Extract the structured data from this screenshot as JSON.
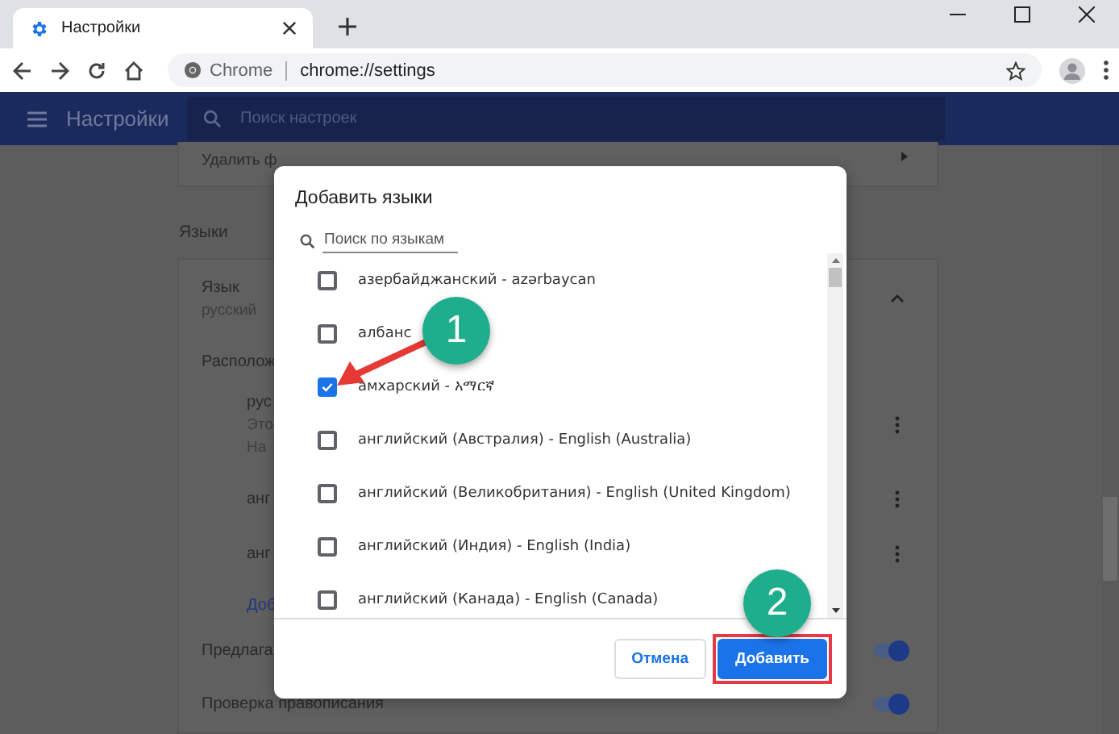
{
  "browser": {
    "tab_title": "Настройки",
    "address_chip": "Chrome",
    "url": "chrome://settings"
  },
  "header": {
    "title": "Настройки",
    "search_placeholder": "Поиск настроек"
  },
  "page": {
    "clear_data_text": "Удалить ф",
    "section_title": "Языки",
    "language_label": "Язык",
    "language_value": "русский",
    "order_label": "Располож",
    "order_items": [
      {
        "lines": [
          "рус",
          "Это",
          "На"
        ]
      },
      {
        "lines": [
          "анг"
        ]
      },
      {
        "lines": [
          "анг"
        ]
      }
    ],
    "add_link": "Доб",
    "toggles": [
      {
        "label": "Предлага",
        "on": true
      },
      {
        "label": "Проверка правописания",
        "on": true
      }
    ]
  },
  "dialog": {
    "title": "Добавить языки",
    "search_placeholder": "Поиск по языкам",
    "languages": [
      {
        "label": "азербайджанский - azərbaycan",
        "checked": false
      },
      {
        "label": "албанс",
        "checked": false
      },
      {
        "label": "амхарский - አማርኛ",
        "checked": true
      },
      {
        "label": "английский (Австралия) - English (Australia)",
        "checked": false
      },
      {
        "label": "английский (Великобритания) - English (United Kingdom)",
        "checked": false
      },
      {
        "label": "английский (Индия) - English (India)",
        "checked": false
      },
      {
        "label": "английский (Канада) - English (Canada)",
        "checked": false
      }
    ],
    "buttons": [
      {
        "label": "Отмена",
        "kind": "secondary",
        "highlighted": false
      },
      {
        "label": "Добавить",
        "kind": "primary",
        "highlighted": true
      }
    ]
  },
  "callouts": [
    {
      "number": "1",
      "kind": "arrow"
    },
    {
      "number": "2",
      "kind": "plain"
    }
  ]
}
